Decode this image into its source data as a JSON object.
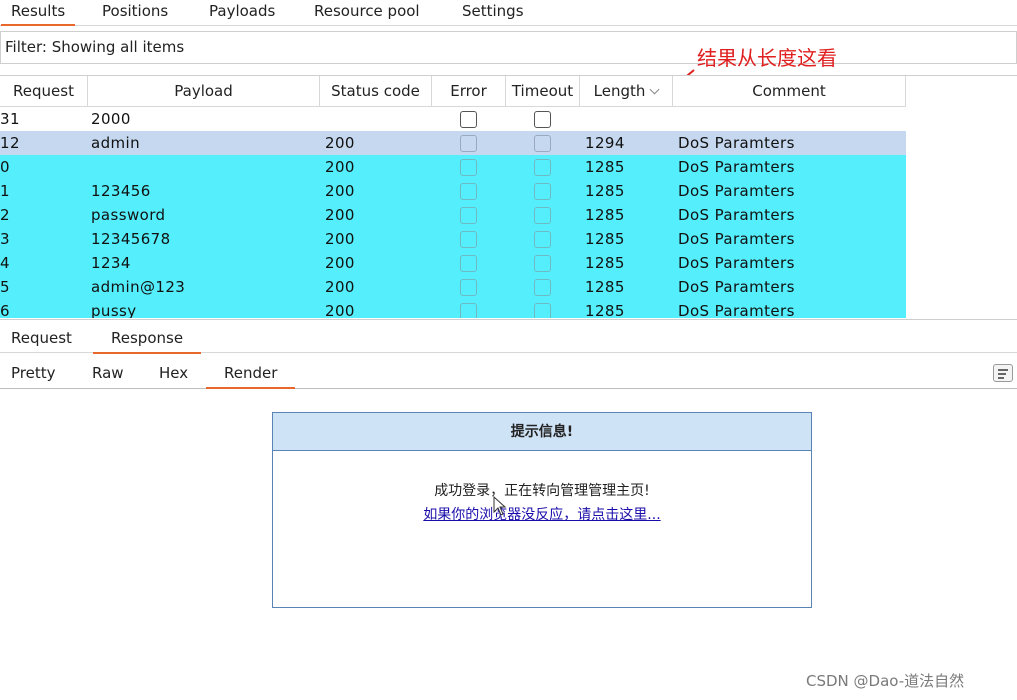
{
  "tabs": {
    "results": "Results",
    "positions": "Positions",
    "payloads": "Payloads",
    "resource_pool": "Resource pool",
    "settings": "Settings"
  },
  "filter_text": "Filter: Showing all items",
  "annotation": "结果从长度这看",
  "table": {
    "headers": [
      "Request",
      "Payload",
      "Status code",
      "Error",
      "Timeout",
      "Length",
      "Comment"
    ],
    "rows": [
      {
        "request": "31",
        "payload": "2000",
        "status": "",
        "length": "",
        "comment": "",
        "style": "white"
      },
      {
        "request": "12",
        "payload": "admin",
        "status": "200",
        "length": "1294",
        "comment": "DoS Paramters",
        "style": "selected"
      },
      {
        "request": "0",
        "payload": "",
        "status": "200",
        "length": "1285",
        "comment": "DoS Paramters",
        "style": "cyan"
      },
      {
        "request": "1",
        "payload": "123456",
        "status": "200",
        "length": "1285",
        "comment": "DoS Paramters",
        "style": "cyan"
      },
      {
        "request": "2",
        "payload": "password",
        "status": "200",
        "length": "1285",
        "comment": "DoS Paramters",
        "style": "cyan"
      },
      {
        "request": "3",
        "payload": "12345678",
        "status": "200",
        "length": "1285",
        "comment": "DoS Paramters",
        "style": "cyan"
      },
      {
        "request": "4",
        "payload": "1234",
        "status": "200",
        "length": "1285",
        "comment": "DoS Paramters",
        "style": "cyan"
      },
      {
        "request": "5",
        "payload": "admin@123",
        "status": "200",
        "length": "1285",
        "comment": "DoS Paramters",
        "style": "cyan"
      },
      {
        "request": "6",
        "payload": "pussy",
        "status": "200",
        "length": "1285",
        "comment": "DoS Paramters",
        "style": "cyan"
      }
    ]
  },
  "message_tabs": {
    "request": "Request",
    "response": "Response"
  },
  "view_tabs": {
    "pretty": "Pretty",
    "raw": "Raw",
    "hex": "Hex",
    "render": "Render"
  },
  "render": {
    "title": "提示信息!",
    "message": "成功登录，正在转向管理管理主页!",
    "link": "如果你的浏览器没反应，请点击这里..."
  },
  "watermark": "CSDN @Dao-道法自然",
  "colors": {
    "accent": "#e8672b",
    "selected_row": "#c6d8ef",
    "highlight_row": "#54eefc",
    "annotation": "#e02020",
    "render_header": "#cfe3f7",
    "render_border": "#5a84b5"
  }
}
